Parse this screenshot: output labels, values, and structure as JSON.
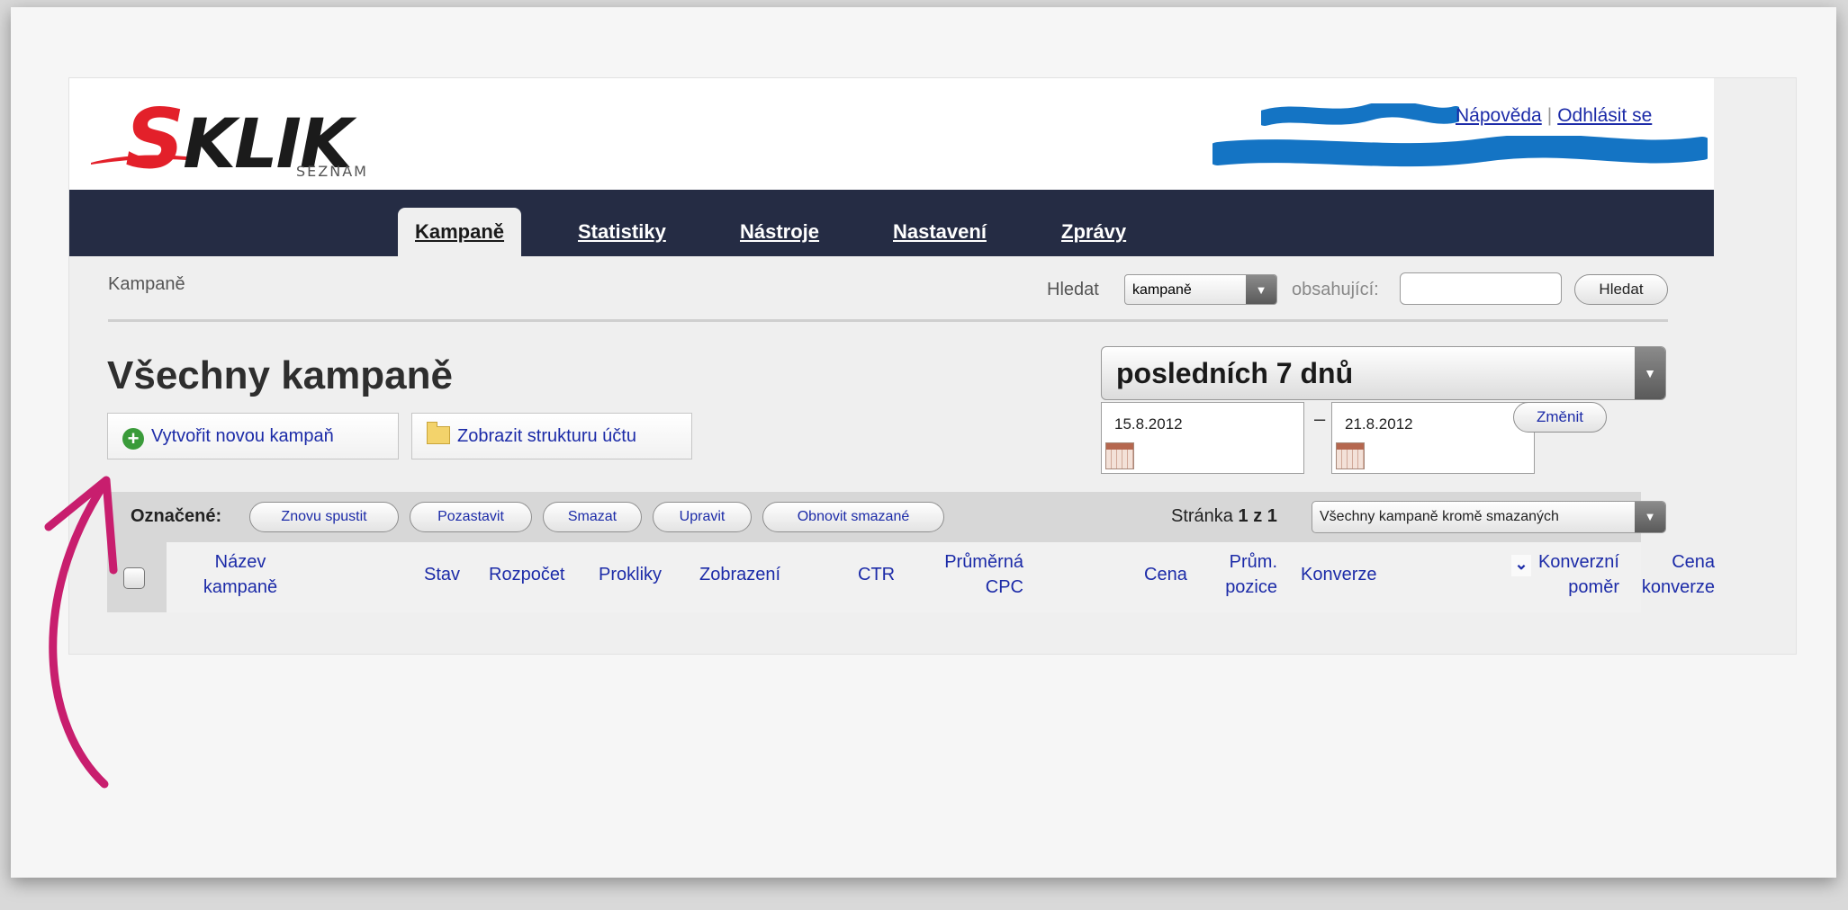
{
  "logo": {
    "text": "SKLIK",
    "sub": "SEZNAM"
  },
  "top_links": {
    "help": "Nápověda",
    "separator": "|",
    "logout": "Odhlásit se"
  },
  "nav": {
    "tabs": [
      {
        "label": "Kampaně",
        "active": true
      },
      {
        "label": "Statistiky",
        "active": false
      },
      {
        "label": "Nástroje",
        "active": false
      },
      {
        "label": "Nastavení",
        "active": false
      },
      {
        "label": "Zprávy",
        "active": false
      }
    ]
  },
  "breadcrumb": "Kampaně",
  "search": {
    "label": "Hledat",
    "scope_selected": "kampaně",
    "contains_label": "obsahující:",
    "value": "",
    "button": "Hledat"
  },
  "page_title": "Všechny kampaně",
  "buttons": {
    "create_campaign": "Vytvořit novou kampaň",
    "show_structure": "Zobrazit strukturu účtu"
  },
  "date_range": {
    "preset_selected": "posledních 7 dnů",
    "from": "15.8.2012",
    "dash": "–",
    "to": "21.8.2012",
    "change_button": "Změnit"
  },
  "action_bar": {
    "label": "Označené:",
    "actions": [
      "Znovu spustit",
      "Pozastavit",
      "Smazat",
      "Upravit",
      "Obnovit smazané"
    ],
    "page_prefix": "Stránka",
    "page_current": "1",
    "page_of": "z",
    "page_total": "1",
    "filter_selected": "Všechny kampaně kromě smazaných"
  },
  "table": {
    "columns": {
      "name_1": "Název",
      "name_2": "kampaně",
      "status": "Stav",
      "budget": "Rozpočet",
      "clicks": "Prokliky",
      "impressions": "Zobrazení",
      "ctr": "CTR",
      "avg_cpc_1": "Průměrná",
      "avg_cpc_2": "CPC",
      "cost": "Cena",
      "avg_pos_1": "Prům.",
      "avg_pos_2": "pozice",
      "conversions": "Konverze",
      "conv_rate_1": "Konverzní",
      "conv_rate_2": "poměr",
      "conv_cost_1": "Cena",
      "conv_cost_2": "konverze"
    }
  },
  "colors": {
    "navbar": "#252c44",
    "link": "#1c2ba8",
    "logo_red": "#e3202a",
    "annotation_arrow": "#c81e6e",
    "scribble": "#1474c4"
  }
}
